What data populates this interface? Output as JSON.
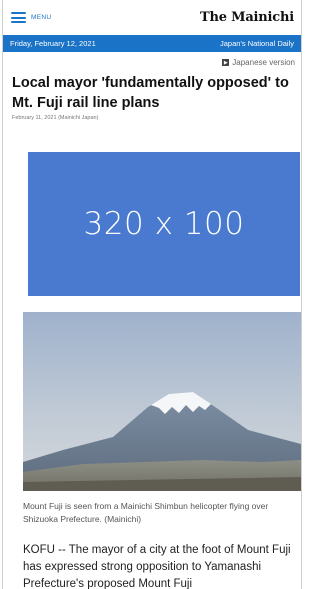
{
  "header": {
    "menu_label": "MENU",
    "logo": "The Mainichi"
  },
  "datebar": {
    "date": "Friday, February 12, 2021",
    "tagline": "Japan's National Daily"
  },
  "japanese_link": "Japanese version",
  "article": {
    "headline": "Local mayor 'fundamentally opposed' to Mt. Fuji rail line plans",
    "byline": "February 11, 2021 (Mainichi Japan)",
    "ad_label": "320 x 100",
    "caption": "Mount Fuji is seen from a Mainichi Shimbun helicopter flying over Shizuoka Prefecture. (Mainichi)",
    "body": "KOFU -- The mayor of a city at the foot of Mount Fuji has expressed strong opposition to Yamanashi Prefecture's proposed Mount Fuji"
  },
  "colors": {
    "accent": "#1a73c6",
    "ad_placeholder": "#4a7ad0"
  },
  "icons": {
    "menu": "hamburger-icon",
    "japanese": "square-icon"
  }
}
